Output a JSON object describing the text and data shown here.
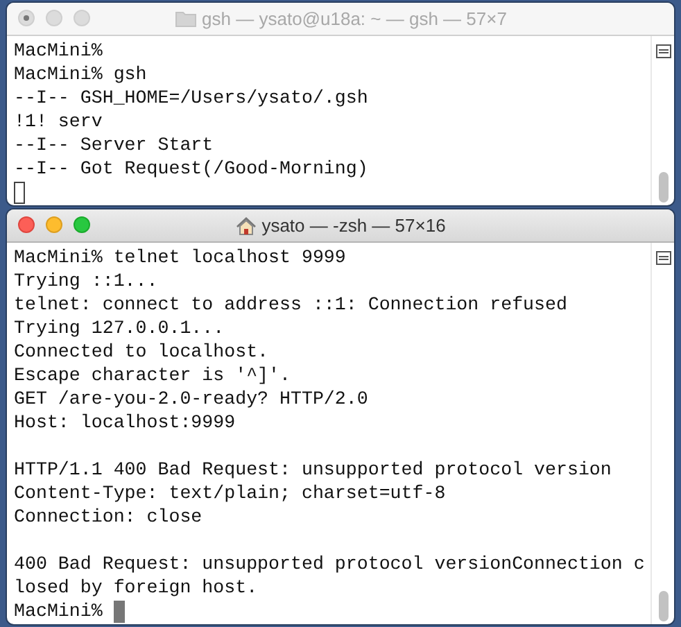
{
  "windows": [
    {
      "title": "gsh — ysato@u18a: ~ — gsh — 57×7",
      "title_icon": {
        "kind": "folder"
      },
      "active": false,
      "lines": [
        {
          "kind": "text",
          "text": "MacMini%"
        },
        {
          "kind": "text",
          "text": "MacMini% gsh"
        },
        {
          "kind": "text",
          "text": "--I-- GSH_HOME=/Users/ysato/.gsh"
        },
        {
          "kind": "text",
          "text": "!1! serv"
        },
        {
          "kind": "text",
          "text": "--I-- Server Start"
        },
        {
          "kind": "text",
          "text": "--I-- Got Request(/Good-Morning)"
        },
        {
          "kind": "cursor"
        }
      ]
    },
    {
      "title": "ysato — -zsh — 57×16",
      "title_icon": {
        "kind": "home"
      },
      "active": true,
      "lines": [
        {
          "kind": "text",
          "text": "MacMini% telnet localhost 9999"
        },
        {
          "kind": "text",
          "text": "Trying ::1..."
        },
        {
          "kind": "text",
          "text": "telnet: connect to address ::1: Connection refused"
        },
        {
          "kind": "text",
          "text": "Trying 127.0.0.1..."
        },
        {
          "kind": "text",
          "text": "Connected to localhost."
        },
        {
          "kind": "text",
          "text": "Escape character is '^]'."
        },
        {
          "kind": "text",
          "text": "GET /are-you-2.0-ready? HTTP/2.0"
        },
        {
          "kind": "text",
          "text": "Host: localhost:9999"
        },
        {
          "kind": "blank"
        },
        {
          "kind": "text",
          "text": "HTTP/1.1 400 Bad Request: unsupported protocol version"
        },
        {
          "kind": "text",
          "text": "Content-Type: text/plain; charset=utf-8"
        },
        {
          "kind": "text",
          "text": "Connection: close"
        },
        {
          "kind": "blank"
        },
        {
          "kind": "text",
          "text": "400 Bad Request: unsupported protocol versionConnection c"
        },
        {
          "kind": "text",
          "text": "losed by foreign host."
        },
        {
          "kind": "cursor",
          "prompt": "MacMini%"
        }
      ]
    }
  ]
}
